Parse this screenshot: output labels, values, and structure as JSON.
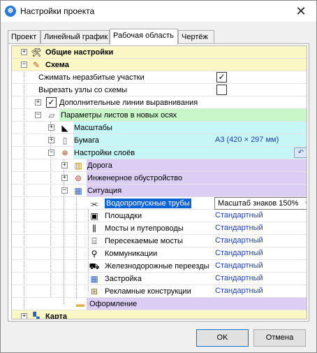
{
  "window": {
    "title": "Настройки проекта",
    "close_glyph": "✕",
    "app_icon_glyph": "⊛"
  },
  "tabs": [
    {
      "label": "Проект"
    },
    {
      "label": "Линейный график"
    },
    {
      "label": "Рабочая область"
    },
    {
      "label": "Чертёж"
    }
  ],
  "colors": {
    "yellow_row": "#fbf7c5",
    "green_row": "#c9f7c9",
    "cyan_row": "#c6f6f6",
    "purple_row": "#dccdf5",
    "value_blue": "#1c3fb0",
    "selection": "#0a64d6"
  },
  "tree": {
    "general": {
      "label": "Общие настройки",
      "icon": "tools-icon"
    },
    "scheme": {
      "label": "Схема",
      "icon": "scheme-icon"
    },
    "compress": {
      "label": "Сжимать неразбитые участки",
      "checked": true
    },
    "cut_nodes": {
      "label": "Вырезать узлы со схемы",
      "checked": false
    },
    "align_lines": {
      "label": "Дополнительные линии выравнивания",
      "checked": true
    },
    "sheet_params": {
      "label": "Параметры листов в новых осях"
    },
    "scales": {
      "label": "Масштабы"
    },
    "paper": {
      "label": "Бумага",
      "value": "А3 (420 × 297 мм)"
    },
    "layers": {
      "label": "Настройки слоёв"
    },
    "road": {
      "label": "Дорога"
    },
    "engineering": {
      "label": "Инженерное обустройство"
    },
    "situation": {
      "label": "Ситуация"
    },
    "culverts": {
      "label": "Водопропускные трубы",
      "value": "Масштаб знаков 150%"
    },
    "platforms": {
      "label": "Площадки",
      "value": "Стандартный"
    },
    "bridges": {
      "label": "Мосты и путепроводы",
      "value": "Стандартный"
    },
    "crossed_bridges": {
      "label": "Пересекаемые мосты",
      "value": "Стандартный"
    },
    "utilities": {
      "label": "Коммуникации",
      "value": "Стандартный"
    },
    "rail_crossings": {
      "label": "Железнодорожные переезды",
      "value": "Стандартный"
    },
    "buildings": {
      "label": "Застройка",
      "value": "Стандартный"
    },
    "billboards": {
      "label": "Рекламные конструкции",
      "value": "Стандартный"
    },
    "decoration": {
      "label": "Оформление"
    },
    "map": {
      "label": "Карта"
    }
  },
  "buttons": {
    "ok": "OK",
    "cancel": "Отмена"
  }
}
